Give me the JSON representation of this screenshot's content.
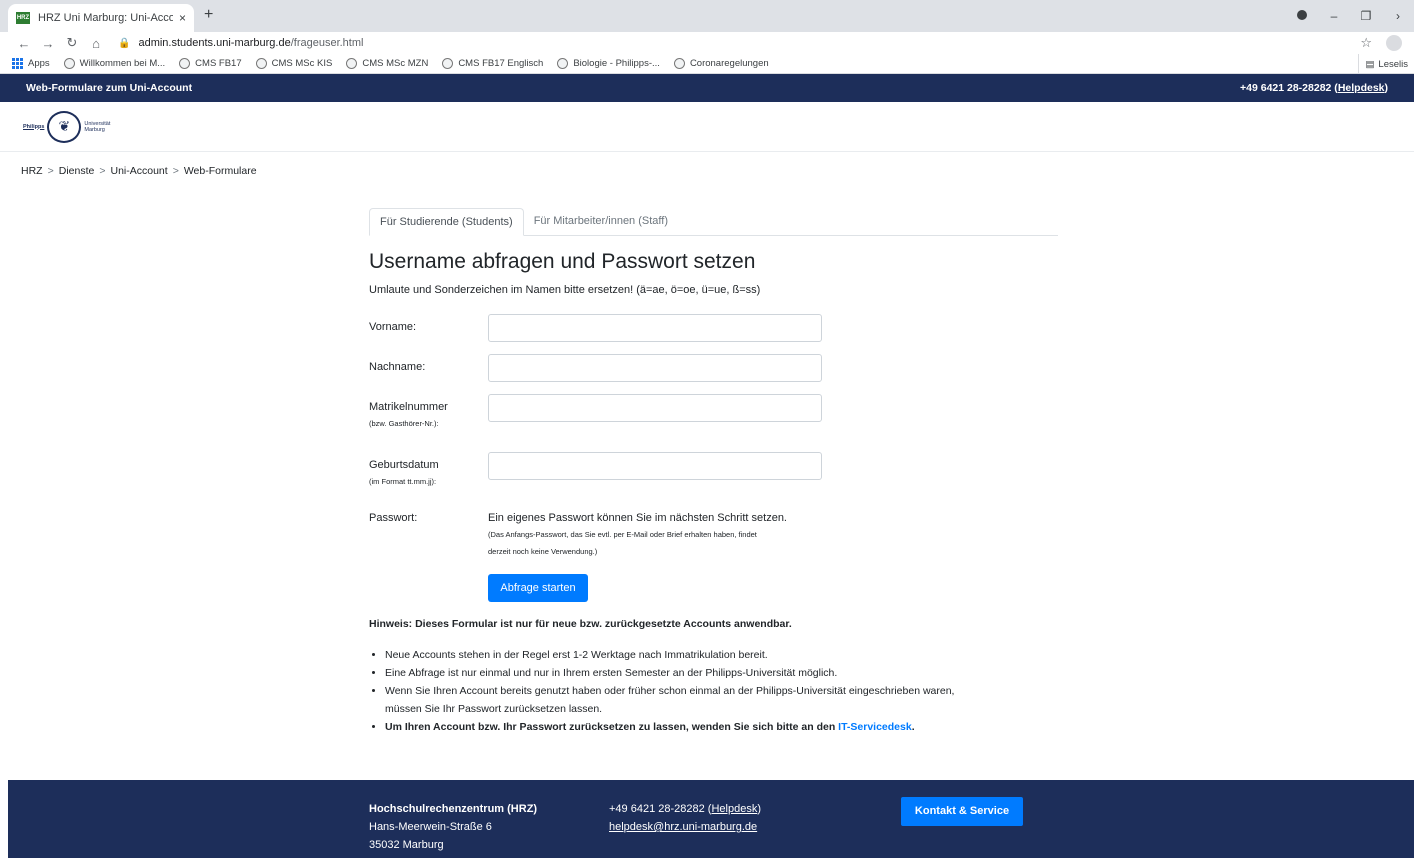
{
  "browser": {
    "tab_title": "HRZ Uni Marburg: Uni-Account |",
    "tab_close": "×",
    "new_tab": "+",
    "url_host": "admin.students.uni-marburg.de",
    "url_path": "/frageuser.html",
    "bookmarks": [
      {
        "label": "Apps"
      },
      {
        "label": "Willkommen bei M..."
      },
      {
        "label": "CMS FB17"
      },
      {
        "label": "CMS MSc KIS"
      },
      {
        "label": "CMS MSc MZN"
      },
      {
        "label": "CMS FB17 Englisch"
      },
      {
        "label": "Biologie - Philipps-..."
      },
      {
        "label": "Coronaregelungen"
      }
    ],
    "reading_list": "Leselis"
  },
  "topbar": {
    "title": "Web-Formulare zum Uni-Account",
    "phone": "+49 6421 28-28282",
    "helpdesk": "Helpdesk"
  },
  "logo": {
    "left": "Philipps",
    "right1": "Universität",
    "right2": "Marburg"
  },
  "breadcrumb": [
    "HRZ",
    "Dienste",
    "Uni-Account",
    "Web-Formulare"
  ],
  "breadcrumb_sep": ">",
  "tabs": [
    {
      "label": "Für Studierende (Students)",
      "active": true
    },
    {
      "label": "Für Mitarbeiter/innen (Staff)",
      "active": false
    }
  ],
  "form": {
    "heading": "Username abfragen und Passwort setzen",
    "subtitle": "Umlaute und Sonderzeichen im Namen bitte ersetzen! (ä=ae, ö=oe, ü=ue, ß=ss)",
    "firstname_label": "Vorname:",
    "firstname_value": "",
    "lastname_label": "Nachname:",
    "lastname_value": "",
    "matrikel_label": "Matrikelnummer",
    "matrikel_hint": "(bzw. Gasthörer-Nr.):",
    "matrikel_value": "",
    "birthdate_label": "Geburtsdatum",
    "birthdate_hint": "(im Format tt.mm.jj):",
    "birthdate_value": "",
    "password_label": "Passwort:",
    "password_text": "Ein eigenes Passwort können Sie im nächsten Schritt setzen.",
    "password_note_1": "(Das Anfangs-Passwort, das Sie evtl. per E-Mail oder Brief erhalten haben, findet",
    "password_note_2": "derzeit noch keine Verwendung.)",
    "submit": "Abfrage starten"
  },
  "notice": {
    "heading": "Hinweis: Dieses Formular ist nur für neue bzw. zurückgesetzte Accounts anwendbar.",
    "item1": "Neue Accounts stehen in der Regel erst 1-2 Werktage nach Immatrikulation bereit.",
    "item2": "Eine Abfrage ist nur einmal und nur in Ihrem ersten Semester an der Philipps-Universität möglich.",
    "item3a": "Wenn Sie Ihren Account bereits genutzt haben oder früher schon einmal an der Philipps-Universität eingeschrieben waren,",
    "item3b": "müssen Sie Ihr Passwort zurücksetzen lassen.",
    "item4": "Um Ihren Account bzw. Ihr Passwort zurücksetzen zu lassen, wenden Sie sich bitte an den ",
    "item4_link": "IT-Servicedesk",
    "item4_end": "."
  },
  "footer": {
    "org": "Hochschulrechenzentrum (HRZ)",
    "street": "Hans-Meerwein-Straße 6",
    "city": "35032 Marburg",
    "phone": "+49 6421 28-28282",
    "helpdesk": "Helpdesk",
    "email": "helpdesk@hrz.uni-marburg.de",
    "button": "Kontakt & Service"
  },
  "colors": {
    "navy": "#1d2e5a",
    "primary": "#007bff"
  }
}
